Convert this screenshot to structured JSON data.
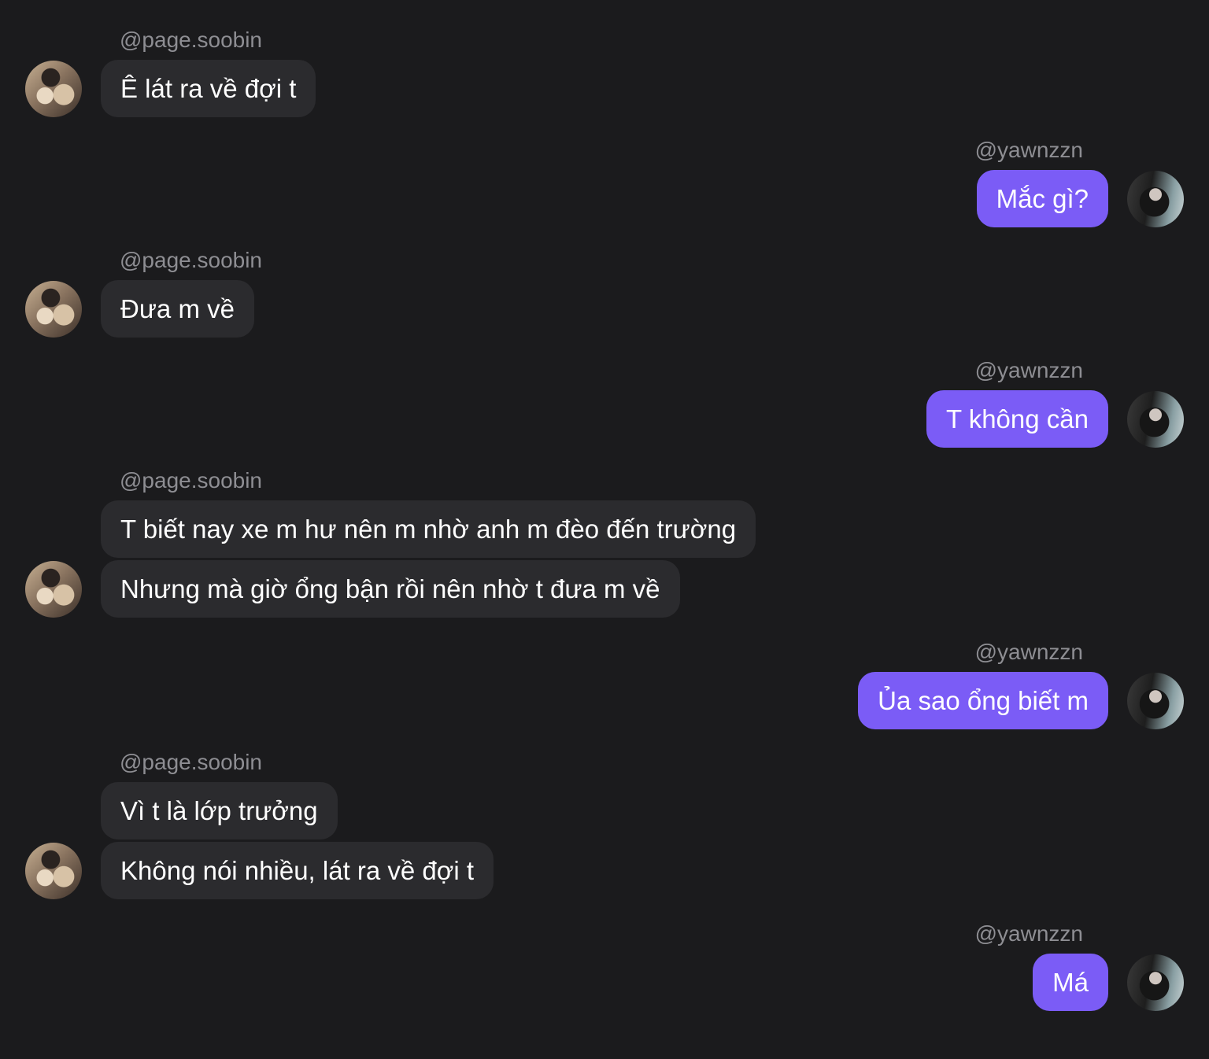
{
  "colors": {
    "background": "#1b1b1d",
    "incoming_bubble": "#2b2b2e",
    "outgoing_bubble": "#7b5cf6",
    "username": "#8e8e93",
    "message_text": "#ffffff"
  },
  "participants": {
    "them": {
      "handle": "@page.soobin",
      "avatar": "avatar-photo-icon"
    },
    "me": {
      "handle": "@yawnzzn",
      "avatar": "avatar-photo-icon"
    }
  },
  "messages": [
    {
      "sender": "@page.soobin",
      "lines": [
        "Ê lát ra về đợi t"
      ]
    },
    {
      "sender": "@yawnzzn",
      "lines": [
        "Mắc gì?"
      ]
    },
    {
      "sender": "@page.soobin",
      "lines": [
        "Đưa m về"
      ]
    },
    {
      "sender": "@yawnzzn",
      "lines": [
        "T không cần"
      ]
    },
    {
      "sender": "@page.soobin",
      "lines": [
        "T biết nay xe m hư nên m nhờ anh m đèo đến trường",
        "Nhưng mà giờ ổng bận rồi nên nhờ t đưa m về"
      ]
    },
    {
      "sender": "@yawnzzn",
      "lines": [
        "Ủa sao ổng biết m"
      ]
    },
    {
      "sender": "@page.soobin",
      "lines": [
        "Vì t là lớp trưởng",
        "Không nói nhiều, lát ra về đợi t"
      ]
    },
    {
      "sender": "@yawnzzn",
      "lines": [
        "Má"
      ]
    }
  ]
}
